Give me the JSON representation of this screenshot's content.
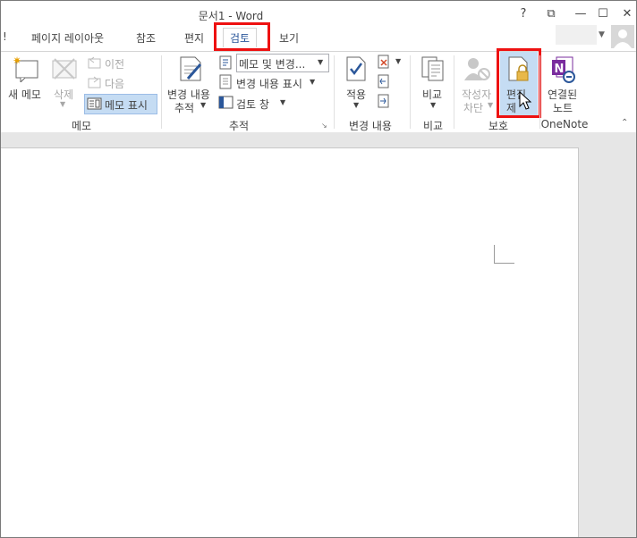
{
  "window": {
    "title": "문서1 - Word",
    "help": "?",
    "restore": "⧉",
    "minimize": "—",
    "maximize": "☐",
    "close": "✕"
  },
  "tabs": [
    {
      "label": "!"
    },
    {
      "label": "페이지 레이아웃"
    },
    {
      "label": "참조"
    },
    {
      "label": "편지"
    },
    {
      "label": "검토"
    },
    {
      "label": "보기"
    }
  ],
  "ribbon": {
    "memo": {
      "new": "새 메모",
      "delete": "삭제",
      "prev": "이전",
      "next": "다음",
      "show": "메모 표시",
      "group": "메모"
    },
    "track": {
      "track_line1": "변경 내용",
      "track_line2": "추적",
      "memo_changes": "메모 및 변경...",
      "show_changes": "변경 내용 표시",
      "review_pane": "검토 창",
      "group": "추적"
    },
    "changes": {
      "apply": "적용",
      "group": "변경 내용"
    },
    "compare": {
      "compare": "비교",
      "group": "비교"
    },
    "protect": {
      "block_line1": "작성자",
      "block_line2": "차단",
      "restrict_line1": "편집",
      "restrict_line2": "제",
      "group": "보호"
    },
    "onenote": {
      "linked_line1": "연결된",
      "linked_line2": "노트",
      "group": "OneNote"
    }
  },
  "colors": {
    "highlight": "#e11111",
    "accent": "#2b579a",
    "onenote": "#7a2c9e"
  }
}
